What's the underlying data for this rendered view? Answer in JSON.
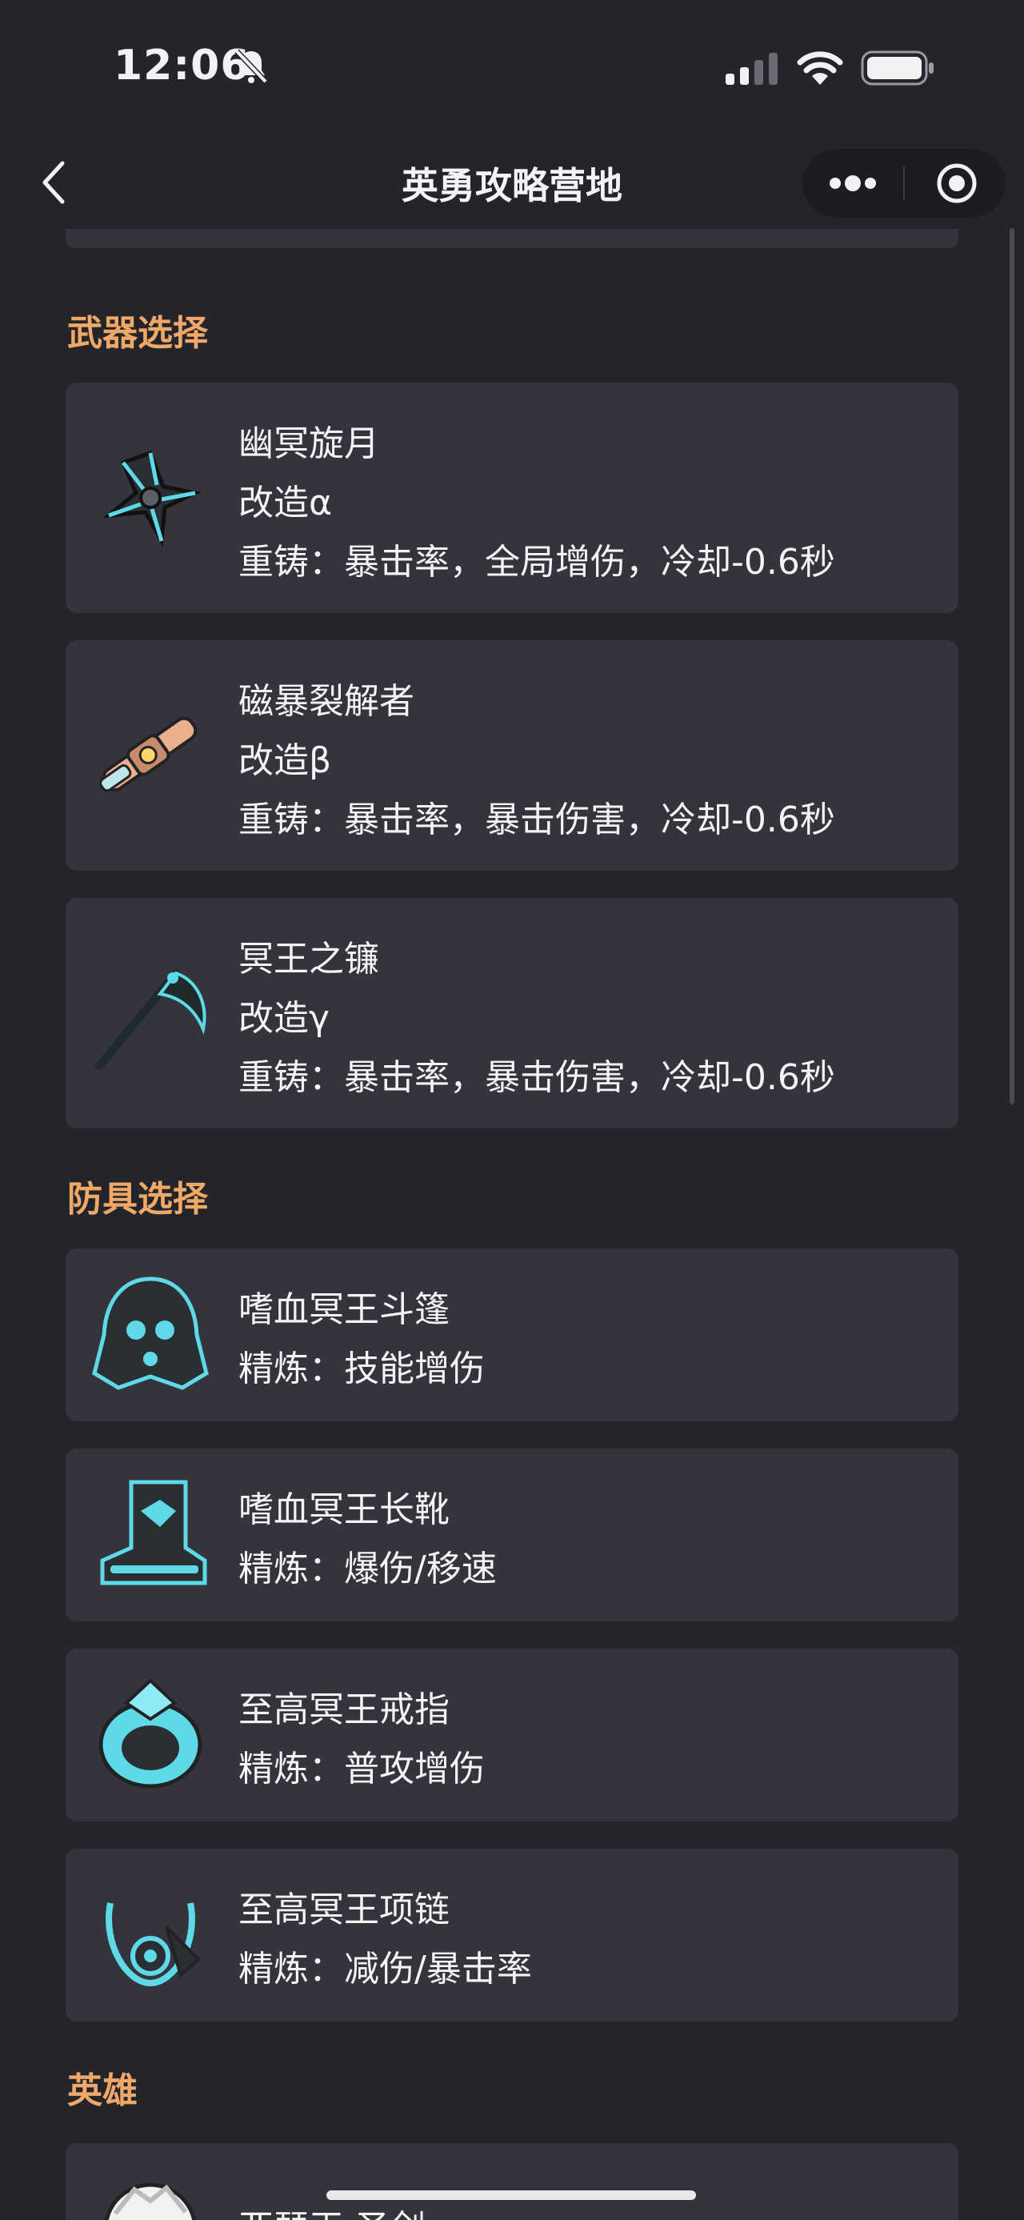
{
  "status_bar": {
    "time": "12:06"
  },
  "nav": {
    "title": "英勇攻略营地"
  },
  "sections": {
    "weapons": {
      "title": "武器选择",
      "items": [
        {
          "name": "幽冥旋月",
          "mod": "改造α",
          "reforge": "重铸：暴击率，全局增伤，冷却-0.6秒",
          "icon": "shuriken-weapon-icon"
        },
        {
          "name": "磁暴裂解者",
          "mod": "改造β",
          "reforge": "重铸：暴击率，暴击伤害，冷却-0.6秒",
          "icon": "energy-blaster-weapon-icon"
        },
        {
          "name": "冥王之镰",
          "mod": "改造γ",
          "reforge": "重铸：暴击率，暴击伤害，冷却-0.6秒",
          "icon": "scythe-weapon-icon"
        }
      ]
    },
    "armor": {
      "title": "防具选择",
      "items": [
        {
          "name": "嗜血冥王斗篷",
          "refine": "精炼：技能增伤",
          "icon": "cloak-armor-icon"
        },
        {
          "name": "嗜血冥王长靴",
          "refine": "精炼：爆伤/移速",
          "icon": "boots-armor-icon"
        },
        {
          "name": "至高冥王戒指",
          "refine": "精炼：普攻增伤",
          "icon": "ring-armor-icon"
        },
        {
          "name": "至高冥王项链",
          "refine": "精炼：减伤/暴击率",
          "icon": "necklace-armor-icon"
        }
      ]
    },
    "heroes": {
      "title": "英雄",
      "items": [
        {
          "name": "亚瑟王·圣剑",
          "icon": "hero-avatar-icon"
        }
      ]
    }
  },
  "colors": {
    "background": "#24252b",
    "card": "#33343c",
    "section_title": "#efa868",
    "text": "#f4f4f6",
    "accent_glow": "#5fd8e8"
  }
}
